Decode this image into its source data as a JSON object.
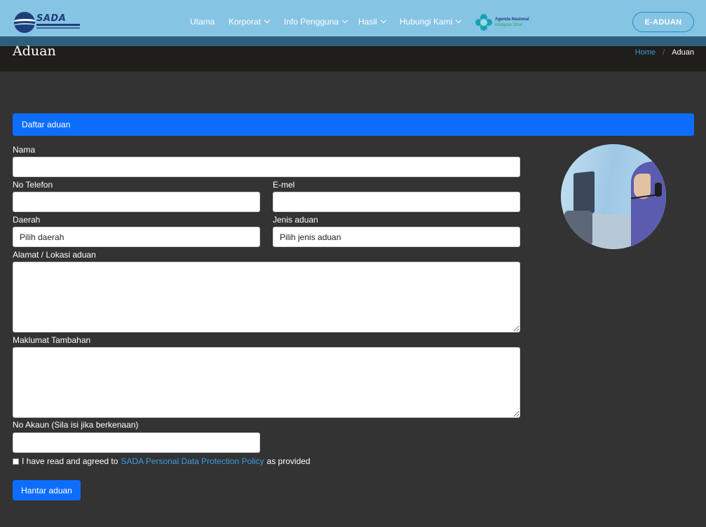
{
  "header": {
    "logo_text": "SADA",
    "nav": [
      {
        "label": "Utama",
        "has_dropdown": false
      },
      {
        "label": "Korporat",
        "has_dropdown": true
      },
      {
        "label": "Info Pengguna",
        "has_dropdown": true
      },
      {
        "label": "Hasil",
        "has_dropdown": true
      },
      {
        "label": "Hubungi Kami",
        "has_dropdown": true
      }
    ],
    "agenda_line1": "Agenda Nasional",
    "agenda_line2": "Malaysia Sihat",
    "eaduan_label": "E-ADUAN"
  },
  "page": {
    "title": "Aduan",
    "breadcrumb": {
      "home": "Home",
      "separator": "/",
      "current": "Aduan"
    }
  },
  "form": {
    "section_title": "Daftar aduan",
    "nama_label": "Nama",
    "telefon_label": "No Telefon",
    "emel_label": "E-mel",
    "daerah_label": "Daerah",
    "daerah_value": "Pilih daerah",
    "jenis_label": "Jenis aduan",
    "jenis_value": "Pilih jenis aduan",
    "alamat_label": "Alamat / Lokasi aduan",
    "maklumat_label": "Maklumat Tambahan",
    "akaun_label": "No Akaun (Sila isi jika berkenaan)",
    "agree_prefix": "I have read and agreed to",
    "agree_link": "SADA Personal Data Protection Policy",
    "agree_suffix": "as provided",
    "submit_label": "Hantar aduan"
  },
  "colors": {
    "header_bg": "#86c4e4",
    "accent_blue": "#0d6efd",
    "link_blue": "#3c9be0",
    "page_bg": "#333333"
  }
}
